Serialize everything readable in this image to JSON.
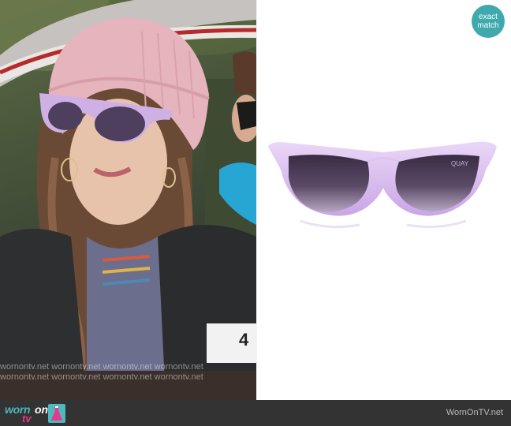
{
  "badge": {
    "line1": "exact",
    "line2": "match"
  },
  "photo": {
    "watermark_lines": [
      "wornontv.net  wornontv.net  wornontv.net  wornontv.net",
      "wornontv.net  wornontv.net  wornontv.net  wornontv.net"
    ],
    "plate_text": "4"
  },
  "product": {
    "brand_mark": "QUAY"
  },
  "footer": {
    "logo_worn": "worn",
    "logo_on": "on",
    "logo_tv": "tv",
    "site_name": "WornOnTV.net"
  },
  "colors": {
    "accent_teal": "#3fa9ad",
    "logo_pink": "#e8378d",
    "frame_lilac": "#d9b8ee",
    "footer_bg": "#333333"
  }
}
